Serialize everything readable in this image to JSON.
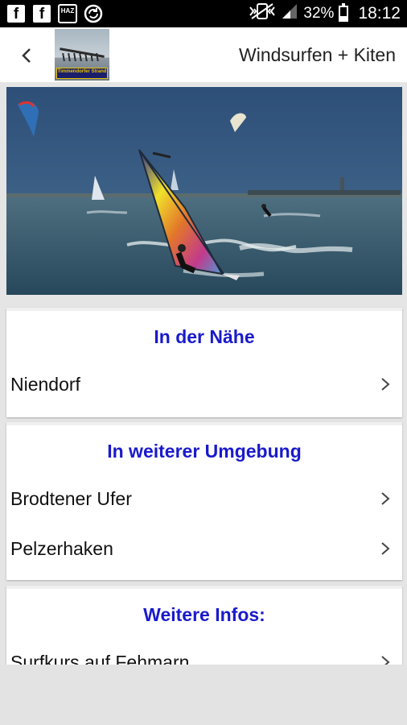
{
  "status_bar": {
    "icons": [
      "facebook-icon",
      "facebook-icon",
      "hazard-news-icon",
      "sync-icon",
      "vibrate-icon",
      "signal-icon",
      "battery-icon"
    ],
    "haz_text": "HAZ",
    "battery_percent": "32%",
    "time": "18:12"
  },
  "app_bar": {
    "title": "Windsurfen + Kiten",
    "logo_text": "Timmendorfer Strand"
  },
  "sections": [
    {
      "heading": "In der Nähe",
      "items": [
        {
          "label": "Niendorf"
        }
      ]
    },
    {
      "heading": "In weiterer Umgebung",
      "items": [
        {
          "label": "Brodtener Ufer"
        },
        {
          "label": "Pelzerhaken"
        }
      ]
    },
    {
      "heading": "Weitere Infos:",
      "items": [
        {
          "label": "Surfkurs auf Fehmarn"
        }
      ]
    }
  ]
}
